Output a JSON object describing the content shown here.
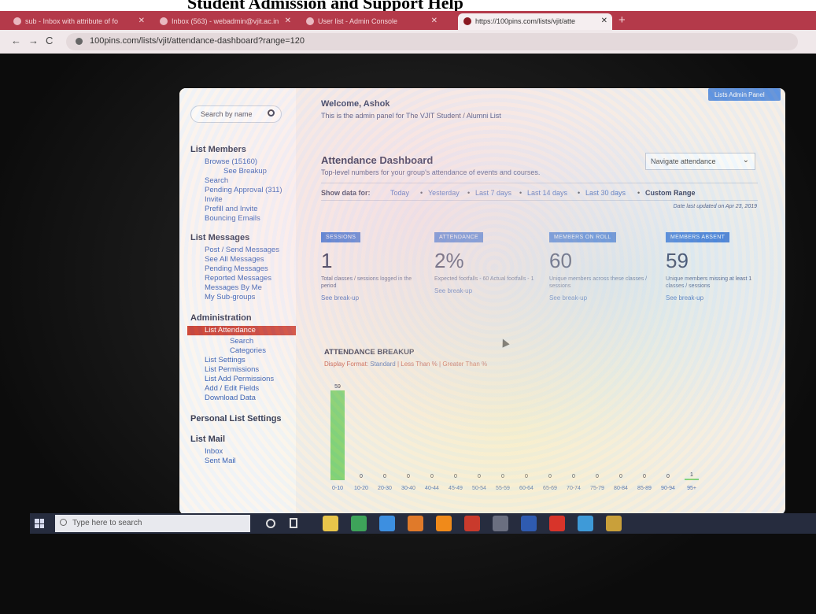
{
  "caption": "Student Admission and Support Help",
  "browser": {
    "tabs": [
      {
        "label": "sub - Inbox with attribute of fo"
      },
      {
        "label": "Inbox (563) - webadmin@vjit.ac.in"
      },
      {
        "label": "User list - Admin Console"
      },
      {
        "label": "https://100pins.com/lists/vjit/atte"
      }
    ],
    "url": "100pins.com/lists/vjit/attendance-dashboard?range=120"
  },
  "sidebar": {
    "search_placeholder": "Search by name",
    "sections": {
      "list_members": "List Members",
      "list_messages": "List Messages",
      "administration": "Administration",
      "personal_settings": "Personal List Settings",
      "list_mail": "List Mail"
    },
    "items": {
      "browse": "Browse (15160)",
      "see_breakup": "See Breakup",
      "search": "Search",
      "pending_approval": "Pending Approval (311)",
      "invite": "Invite",
      "prefill_invite": "Prefill and Invite",
      "bouncing": "Bouncing Emails",
      "post_send": "Post / Send Messages",
      "see_all": "See All Messages",
      "pending_messages": "Pending Messages",
      "reported": "Reported Messages",
      "by_me": "Messages By Me",
      "sub_groups": "My Sub-groups",
      "list_attendance": "List Attendance",
      "att_search": "Search",
      "att_categories": "Categories",
      "list_settings": "List Settings",
      "list_permissions": "List Permissions",
      "add_permissions": "List Add Permissions",
      "edit_fields": "Add / Edit Fields",
      "download": "Download Data",
      "inbox": "Inbox",
      "sent_mail": "Sent Mail"
    }
  },
  "header": {
    "admin_button": "Lists Admin Panel",
    "welcome": "Welcome, Ashok",
    "intro": "This is the admin panel for The VJIT Student / Alumni List"
  },
  "dashboard": {
    "title": "Attendance Dashboard",
    "subtitle": "Top-level numbers for your group's attendance of events and courses.",
    "navigate": "Navigate attendance",
    "show_label": "Show data for:",
    "ranges": [
      "Today",
      "Yesterday",
      "Last 7 days",
      "Last 14 days",
      "Last 30 days",
      "Custom Range"
    ],
    "selected_range": "Custom Range",
    "updated": "Date last updated on Apr 23, 2019",
    "stats": [
      {
        "badge": "SESSIONS",
        "value": "1",
        "desc": "Total classes / sessions logged in the period",
        "link": "See break-up"
      },
      {
        "badge": "ATTENDANCE",
        "value": "2%",
        "desc": "Expected footfalls - 60 Actual footfalls - 1",
        "link": "See break-up"
      },
      {
        "badge": "MEMBERS ON ROLL",
        "value": "60",
        "desc": "Unique members across these classes / sessions",
        "link": "See break-up"
      },
      {
        "badge": "MEMBERS ABSENT",
        "value": "59",
        "desc": "Unique members missing at least 1 classes / sessions",
        "link": "See break-up"
      }
    ],
    "breakup_title": "ATTENDANCE BREAKUP",
    "format_label": "Display Format:",
    "formats": [
      "Standard",
      "Less Than %",
      "Greater Than %"
    ]
  },
  "chart_data": {
    "type": "bar",
    "categories": [
      "0-10",
      "10-20",
      "20-30",
      "30-40",
      "40-44",
      "45-49",
      "50-54",
      "55-59",
      "60-64",
      "65-69",
      "70-74",
      "75-79",
      "80-84",
      "85-89",
      "90-94",
      "95+"
    ],
    "values": [
      59,
      0,
      0,
      0,
      0,
      0,
      0,
      0,
      0,
      0,
      0,
      0,
      0,
      0,
      0,
      1
    ],
    "ylim": [
      0,
      60
    ],
    "bar_color": "#6fcf6a"
  },
  "taskbar": {
    "search_placeholder": "Type here to search",
    "apps": [
      "chrome-icon",
      "app-icon",
      "store-icon",
      "firefox-icon",
      "vlc-icon",
      "filezilla-icon",
      "camera-icon",
      "word-icon",
      "acrobat-icon",
      "settings-icon",
      "photos-icon"
    ]
  },
  "colors": {
    "accent": "#2f6bd0",
    "active_item": "#c9382c",
    "tab_bar": "#b43a4a"
  }
}
